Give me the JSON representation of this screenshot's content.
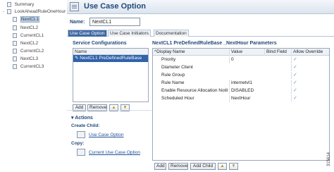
{
  "tree": {
    "items": [
      {
        "label": "Summary",
        "toggle": ""
      },
      {
        "label": "LookAheadRuleOneHour",
        "toggle": "-"
      },
      {
        "label": "NextCL1",
        "toggle": ""
      },
      {
        "label": "NextCL2",
        "toggle": ""
      },
      {
        "label": "CurrentCL1",
        "toggle": ""
      },
      {
        "label": "NextCL2",
        "toggle": ""
      },
      {
        "label": "CurrentCL2",
        "toggle": ""
      },
      {
        "label": "NextCL3",
        "toggle": ""
      },
      {
        "label": "CurrentCL3",
        "toggle": ""
      }
    ]
  },
  "header": {
    "title": "Use Case Option"
  },
  "name_field": {
    "label": "Name:",
    "value": "NextCL1"
  },
  "tabs": [
    "Use Case Option",
    "Use Case Initiators",
    "Documentation"
  ],
  "service_configurations": {
    "title": "Service Configurations",
    "column": "Name",
    "rows": [
      "NextCL1 PreDefinedRuleBase"
    ],
    "buttons": {
      "add": "Add",
      "remove": "Remove",
      "up": "▲",
      "down": "▼"
    }
  },
  "actions": {
    "title": "Actions",
    "create_child_label": "Create Child:",
    "create_child_link": "Use Case Option",
    "copy_label": "Copy:",
    "copy_link": "Current Use Case Option"
  },
  "parameters": {
    "title": "NextCL1 PreDefinedRuleBase _NextHour Parameters",
    "columns": [
      "Display Name",
      "Value",
      "Bind Field",
      "Allow Override"
    ],
    "rows": [
      {
        "name": "Priority",
        "value": "0",
        "bind": "",
        "override": "✓"
      },
      {
        "name": "Diameter Client",
        "value": "",
        "bind": "",
        "override": "✓"
      },
      {
        "name": "Rule Group",
        "value": "",
        "bind": "",
        "override": "✓"
      },
      {
        "name": "Rule Name",
        "value": "internetvl1",
        "bind": "",
        "override": "✓"
      },
      {
        "name": "Enable Resource Allocation Notif",
        "value": "DISABLED",
        "bind": "",
        "override": "✓"
      },
      {
        "name": "Scheduled Hour",
        "value": "NextHour",
        "bind": "",
        "override": "✓"
      }
    ],
    "buttons": {
      "add": "Add",
      "remove": "Remove",
      "add_child": "Add Child",
      "up": "▲",
      "down": "▼"
    }
  },
  "figure_id": "315614",
  "colors": {
    "accent": "#234a7a",
    "selection": "#2f63a9",
    "tab_active": "#3f6aa3"
  }
}
